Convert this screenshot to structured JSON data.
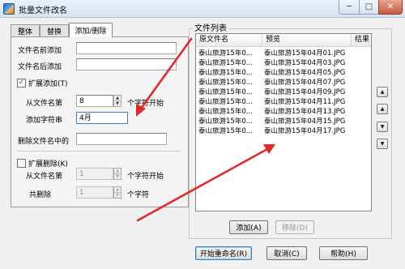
{
  "window": {
    "title": "批量文件改名",
    "close_glyph": "✕",
    "minimize_glyph": "─",
    "maximize_glyph": "□"
  },
  "tabs": [
    {
      "label": "整体"
    },
    {
      "label": "替换"
    },
    {
      "label": "添加/删除"
    }
  ],
  "add_panel": {
    "prefix_label": "文件名前添加",
    "prefix_value": "",
    "suffix_label": "文件名后添加",
    "suffix_value": "",
    "extended_add_label": "扩展添加(T)",
    "extended_add_checked": true,
    "from_pos_label": "从文件名第",
    "from_pos_value": "8",
    "char_start_label": "个字符开始",
    "add_string_label": "添加字符串",
    "add_string_value": "4月",
    "delete_in_name_label": "删除文件名中的",
    "delete_in_name_value": ""
  },
  "delete_panel": {
    "extended_delete_label": "扩展删除(K)",
    "extended_delete_checked": false,
    "from_pos_label": "从文件名第",
    "from_pos_value": "1",
    "char_start_label": "个字符开始",
    "total_delete_label": "共删除",
    "total_delete_value": "1",
    "chars_label": "个字符"
  },
  "file_list": {
    "title": "文件列表",
    "columns": [
      "原文件名",
      "预览",
      "结果"
    ],
    "rows": [
      {
        "original": "泰山旅游15年0...",
        "preview": "泰山旅游15年04月01.JPG",
        "result": ""
      },
      {
        "original": "泰山旅游15年0...",
        "preview": "泰山旅游15年04月03.JPG",
        "result": ""
      },
      {
        "original": "泰山旅游15年0...",
        "preview": "泰山旅游15年04月05.JPG",
        "result": ""
      },
      {
        "original": "泰山旅游15年0...",
        "preview": "泰山旅游15年04月07.JPG",
        "result": ""
      },
      {
        "original": "泰山旅游15年0...",
        "preview": "泰山旅游15年04月09.JPG",
        "result": ""
      },
      {
        "original": "泰山旅游15年0...",
        "preview": "泰山旅游15年04月11.JPG",
        "result": ""
      },
      {
        "original": "泰山旅游15年0...",
        "preview": "泰山旅游15年04月13.JPG",
        "result": ""
      },
      {
        "original": "泰山旅游15年0...",
        "preview": "泰山旅游15年04月15.JPG",
        "result": ""
      },
      {
        "original": "泰山旅游15年0...",
        "preview": "泰山旅游15年04月17.JPG",
        "result": ""
      }
    ],
    "add_button": "添加(A)",
    "remove_button": "移除(D)",
    "order_icons": [
      "move-top-icon",
      "move-up-icon",
      "move-down-icon",
      "move-bottom-icon"
    ]
  },
  "footer": {
    "start_rename": "开始重命名(R)",
    "cancel": "取消(C)",
    "help": "帮助(H)"
  },
  "colors": {
    "annotation_arrow": "#e02a2a",
    "title_bar": "#d6e3f1",
    "close_button": "#c85a41"
  }
}
